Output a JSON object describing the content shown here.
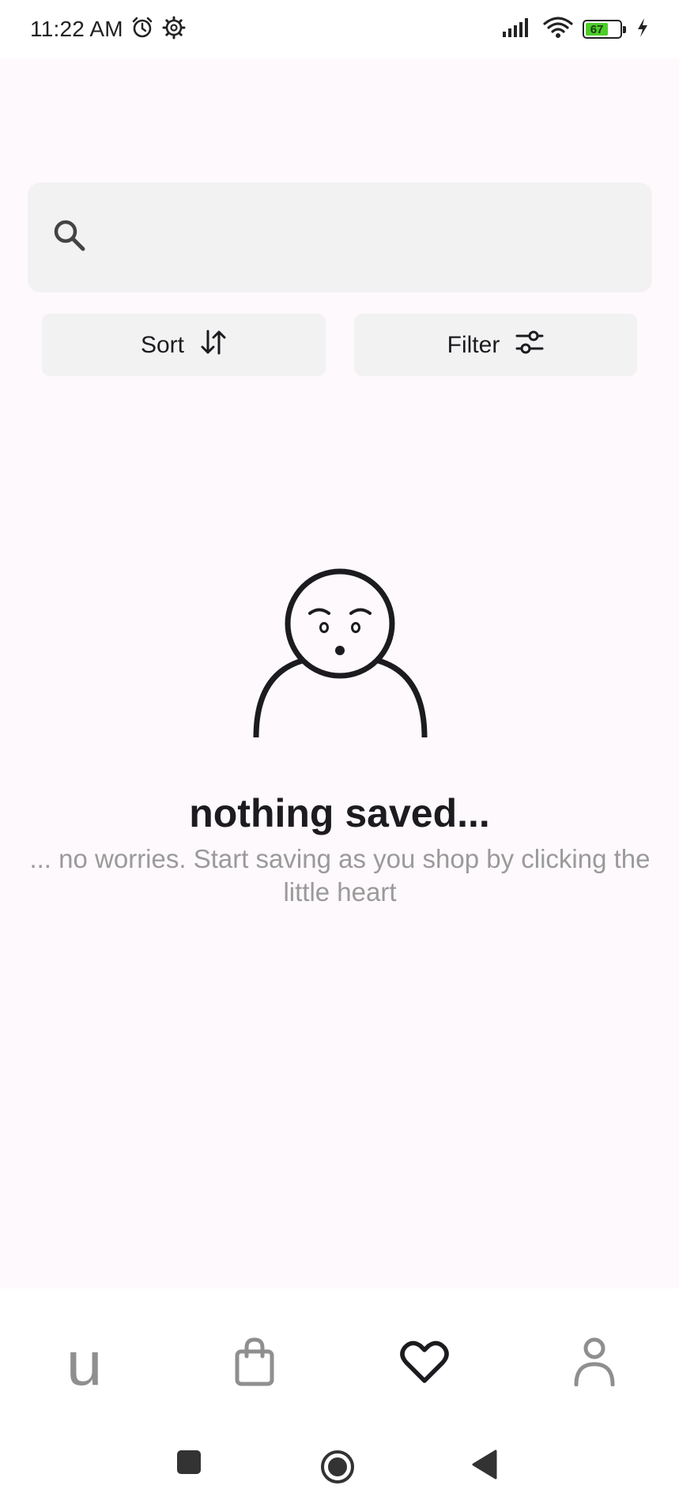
{
  "status_bar": {
    "time": "11:22 AM",
    "battery_level": "67",
    "icons": [
      "alarm-icon",
      "settings-gear-icon",
      "signal-icon",
      "wifi-icon",
      "battery-icon",
      "charging-bolt-icon"
    ]
  },
  "search": {
    "placeholder": "",
    "value": "",
    "icon": "search-icon"
  },
  "toolbar": {
    "sort_label": "Sort",
    "sort_icon": "sort-arrows-icon",
    "filter_label": "Filter",
    "filter_icon": "filter-sliders-icon"
  },
  "empty_state": {
    "illustration": "confused-person-icon",
    "title": "nothing saved...",
    "subtitle": "... no worries. Start saving as you shop by clicking the little heart"
  },
  "bottom_nav": {
    "items": [
      {
        "name": "home",
        "glyph": "u",
        "icon": "brand-u-icon",
        "active": false
      },
      {
        "name": "bag",
        "icon": "shopping-bag-icon",
        "active": false
      },
      {
        "name": "saved",
        "icon": "heart-icon",
        "active": true
      },
      {
        "name": "profile",
        "icon": "person-icon",
        "active": false
      }
    ]
  },
  "colors": {
    "background": "#fdf9fc",
    "surface": "#f2f2f2",
    "text_primary": "#1c1b1f",
    "text_secondary": "#9a9a9a",
    "nav_inactive": "#8f8f8f",
    "battery_green": "#4ccd2a"
  }
}
